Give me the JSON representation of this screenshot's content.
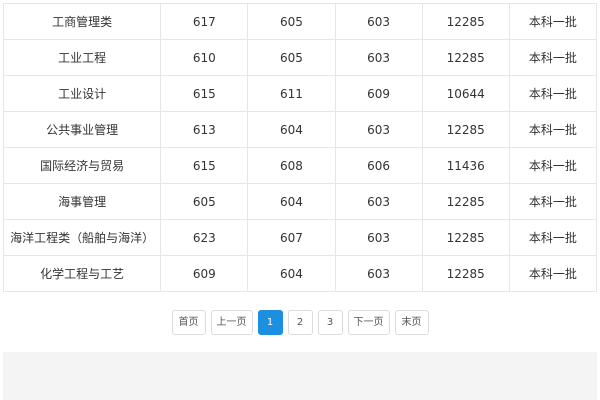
{
  "table": {
    "rows": [
      {
        "major": "工商管理类",
        "c1": "617",
        "c2": "605",
        "c3": "603",
        "c4": "12285",
        "batch": "本科一批"
      },
      {
        "major": "工业工程",
        "c1": "610",
        "c2": "605",
        "c3": "603",
        "c4": "12285",
        "batch": "本科一批"
      },
      {
        "major": "工业设计",
        "c1": "615",
        "c2": "611",
        "c3": "609",
        "c4": "10644",
        "batch": "本科一批"
      },
      {
        "major": "公共事业管理",
        "c1": "613",
        "c2": "604",
        "c3": "603",
        "c4": "12285",
        "batch": "本科一批"
      },
      {
        "major": "国际经济与贸易",
        "c1": "615",
        "c2": "608",
        "c3": "606",
        "c4": "11436",
        "batch": "本科一批"
      },
      {
        "major": "海事管理",
        "c1": "605",
        "c2": "604",
        "c3": "603",
        "c4": "12285",
        "batch": "本科一批"
      },
      {
        "major": "海洋工程类（船舶与海洋）",
        "c1": "623",
        "c2": "607",
        "c3": "603",
        "c4": "12285",
        "batch": "本科一批"
      },
      {
        "major": "化学工程与工艺",
        "c1": "609",
        "c2": "604",
        "c3": "603",
        "c4": "12285",
        "batch": "本科一批"
      }
    ]
  },
  "pagination": {
    "first": "首页",
    "prev": "上一页",
    "pages": [
      "1",
      "2",
      "3"
    ],
    "current": "1",
    "next": "下一页",
    "last": "末页",
    "active_color": "#1c8fe0"
  }
}
